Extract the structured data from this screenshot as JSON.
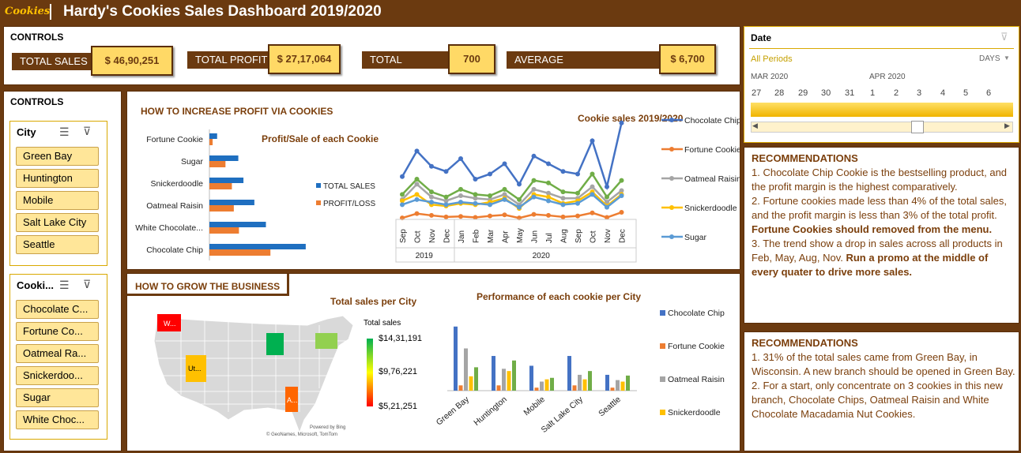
{
  "header": {
    "logo": "Cookies",
    "title": "Hardy's Cookies Sales Dashboard 2019/2020"
  },
  "kpis": {
    "heading": "CONTROLS",
    "items": [
      {
        "label": "TOTAL SALES",
        "value": "$ 46,90,251"
      },
      {
        "label": "TOTAL PROFIT",
        "value": "$ 27,17,064"
      },
      {
        "label": "TOTAL ORDERS",
        "value": "700"
      },
      {
        "label": "AVERAGE PURCHASE/ORDER",
        "value": "$ 6,700"
      }
    ]
  },
  "controls_heading": "CONTROLS",
  "city_slicer": {
    "title": "City",
    "items": [
      "Green Bay",
      "Huntington",
      "Mobile",
      "Salt Lake City",
      "Seattle"
    ]
  },
  "cookie_slicer": {
    "title": "Cooki...",
    "items": [
      "Chocolate C...",
      "Fortune Co...",
      "Oatmeal Ra...",
      "Snickerdoo...",
      "Sugar",
      "White Choc..."
    ]
  },
  "profit_section": {
    "title": "HOW TO INCREASE PROFIT VIA COOKIES",
    "bar_title": "Profit/Sale of each Cookie",
    "line_title": "Cookie sales 2019/2020"
  },
  "grow_section": {
    "title": "HOW TO GROW THE BUSINESS",
    "map_title": "Total sales per City",
    "map_legend_title": "Total sales",
    "map_legend_values": [
      "$14,31,191",
      "$9,76,221",
      "$5,21,251"
    ],
    "map_labels": [
      "W...",
      "Ut...",
      "A..."
    ],
    "map_credit1": "Powered by Bing",
    "map_credit2": "© GeoNames, Microsoft, TomTom",
    "col_title": "Performance of each cookie per City"
  },
  "date_slicer": {
    "title": "Date",
    "periods": "All Periods",
    "unit": "DAYS",
    "months": [
      "MAR 2020",
      "APR 2020"
    ],
    "days": [
      "27",
      "28",
      "29",
      "30",
      "31",
      "1",
      "2",
      "3",
      "4",
      "5",
      "6"
    ]
  },
  "rec1": {
    "title": "RECOMMENDATIONS",
    "p1": "1. Chocolate Chip Cookie is the bestselling product, and the profit margin is the highest comparatively.",
    "p2": "2. Fortune cookies made less than 4% of the total sales, and the profit margin is less than 3% of the total profit.",
    "p3": "Fortune Cookies should removed from the menu.",
    "p4a": "3. The trend show a drop in sales across all products in Feb, May, Aug, Nov. ",
    "p4b": "Run a promo at the middle of every quater to drive more sales."
  },
  "rec2": {
    "title": "RECOMMENDATIONS",
    "p1": "1. 31% of the total sales came from Green Bay, in Wisconsin. A new branch should be opened in Green Bay.",
    "p2": "2. For a start, only concentrate on 3 cookies in this new branch, Chocolate Chips, Oatmeal Raisin and White Chocolate Macadamia Nut Cookies."
  },
  "colors": {
    "brown": "#6b3a10",
    "gold": "#ffd966",
    "blue": "#4472c4",
    "orange": "#ed7d31",
    "gray": "#a5a5a5",
    "yellow": "#ffc000",
    "lightblue": "#5b9bd5",
    "green": "#70ad47",
    "barblue": "#1f6fc0"
  },
  "chart_data": [
    {
      "type": "bar",
      "title": "Profit/Sale of each Cookie",
      "categories": [
        "Fortune Cookie",
        "Sugar",
        "Snickerdoodle",
        "Oatmeal Raisin",
        "White Chocolate...",
        "Chocolate Chip"
      ],
      "series": [
        {
          "name": "TOTAL SALES",
          "values": [
            120000,
            450000,
            530000,
            700000,
            880000,
            1500000
          ]
        },
        {
          "name": "PROFIT/LOSS",
          "values": [
            50000,
            250000,
            350000,
            380000,
            460000,
            950000
          ]
        }
      ]
    },
    {
      "type": "line",
      "title": "Cookie sales 2019/2020",
      "categories": [
        "Sep",
        "Oct",
        "Nov",
        "Dec",
        "Jan",
        "Feb",
        "Mar",
        "Apr",
        "May",
        "Jun",
        "Jul",
        "Aug",
        "Sep",
        "Oct",
        "Nov",
        "Dec"
      ],
      "groups": [
        {
          "label": "2019",
          "count": 4
        },
        {
          "label": "2020",
          "count": 12
        }
      ],
      "series": [
        {
          "name": "Chocolate Chip",
          "values": [
            180000,
            280000,
            220000,
            200000,
            250000,
            170000,
            190000,
            230000,
            150000,
            260000,
            230000,
            200000,
            190000,
            320000,
            140000,
            390000
          ]
        },
        {
          "name": "Fortune Cookie",
          "values": [
            18000,
            35000,
            28000,
            22000,
            24000,
            20000,
            26000,
            30000,
            18000,
            32000,
            28000,
            22000,
            26000,
            38000,
            20000,
            40000
          ]
        },
        {
          "name": "Oatmeal Raisin",
          "values": [
            90000,
            150000,
            100000,
            85000,
            105000,
            95000,
            90000,
            110000,
            70000,
            130000,
            115000,
            95000,
            95000,
            140000,
            80000,
            125000
          ]
        },
        {
          "name": "Snickerdoodle",
          "values": [
            85000,
            110000,
            70000,
            65000,
            75000,
            70000,
            80000,
            95000,
            55000,
            110000,
            100000,
            75000,
            85000,
            120000,
            65000,
            110000
          ]
        },
        {
          "name": "Sugar",
          "values": [
            70000,
            90000,
            80000,
            70000,
            80000,
            75000,
            70000,
            90000,
            60000,
            100000,
            85000,
            70000,
            75000,
            110000,
            60000,
            105000
          ]
        },
        {
          "name": "",
          "values": [
            110000,
            170000,
            120000,
            100000,
            130000,
            110000,
            105000,
            130000,
            90000,
            165000,
            155000,
            120000,
            115000,
            190000,
            100000,
            165000
          ]
        }
      ]
    },
    {
      "type": "bar",
      "title": "Performance of each cookie per City",
      "categories": [
        "Green Bay",
        "Huntington",
        "Mobile",
        "Salt Lake City",
        "Seattle"
      ],
      "series": [
        {
          "name": "Chocolate Chip",
          "values": [
            850000,
            460000,
            330000,
            460000,
            210000
          ]
        },
        {
          "name": "Fortune Cookie",
          "values": [
            70000,
            70000,
            40000,
            70000,
            40000
          ]
        },
        {
          "name": "Oatmeal Raisin",
          "values": [
            560000,
            290000,
            120000,
            210000,
            140000
          ]
        },
        {
          "name": "Snickerdoodle",
          "values": [
            190000,
            260000,
            150000,
            150000,
            120000
          ]
        },
        {
          "name": "",
          "values": [
            310000,
            400000,
            170000,
            260000,
            200000
          ]
        }
      ],
      "legend": [
        "Chocolate Chip",
        "Fortune Cookie",
        "Oatmeal Raisin",
        "Snickerdoodle"
      ]
    }
  ]
}
